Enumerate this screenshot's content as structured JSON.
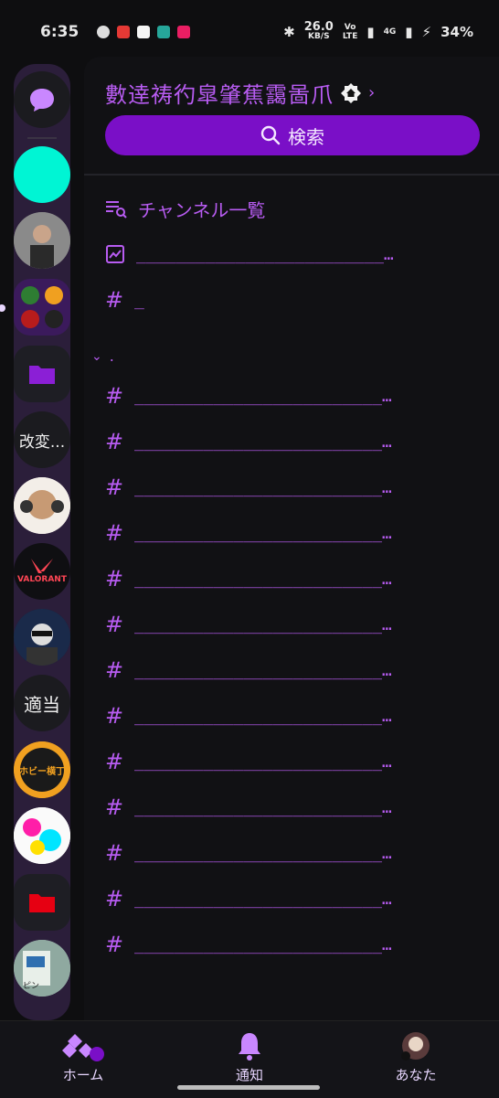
{
  "status": {
    "time": "6:35",
    "net_speed": "26.0",
    "net_unit": "KB/S",
    "volte_top": "Vo",
    "volte_bottom": "LTE",
    "net_type": "4G",
    "battery": "34%"
  },
  "rail": {
    "servers": [
      {
        "name": "direct-messages"
      },
      {
        "name": "server-teal"
      },
      {
        "name": "server-man"
      },
      {
        "name": "server-folder-group"
      },
      {
        "name": "server-folder"
      },
      {
        "name": "server-text",
        "text": "改変..."
      },
      {
        "name": "server-anime"
      },
      {
        "name": "server-valorant",
        "text": "VALORANT"
      },
      {
        "name": "server-collage"
      },
      {
        "name": "server-text-2",
        "text": "適当"
      },
      {
        "name": "server-hobby",
        "text": "ホビー横丁"
      },
      {
        "name": "server-colorful"
      },
      {
        "name": "server-folder-red"
      },
      {
        "name": "server-sign",
        "text": "ピン"
      }
    ]
  },
  "guild": {
    "name": "數逹祷彴皐肇蕉靄啚爪",
    "search_label": "検索",
    "channels_list_label": "チャンネル一覧",
    "pinned_channel": "_________________________…",
    "short_channel": "_",
    "category_name": ".",
    "channels": [
      "_________________________…",
      "_________________________…",
      "_________________________…",
      "_________________________…",
      "_________________________…",
      "_________________________…",
      "_________________________…",
      "_________________________…",
      "_________________________…",
      "_________________________…",
      "_________________________…",
      "_________________________…",
      "_________________________…"
    ]
  },
  "bottom_nav": {
    "home": "ホーム",
    "notifications": "通知",
    "you": "あなた"
  },
  "colors": {
    "accent": "#b85cf2",
    "search_bg": "#7a0fc7",
    "teal": "#00f5d4",
    "background": "#0e0e10"
  }
}
